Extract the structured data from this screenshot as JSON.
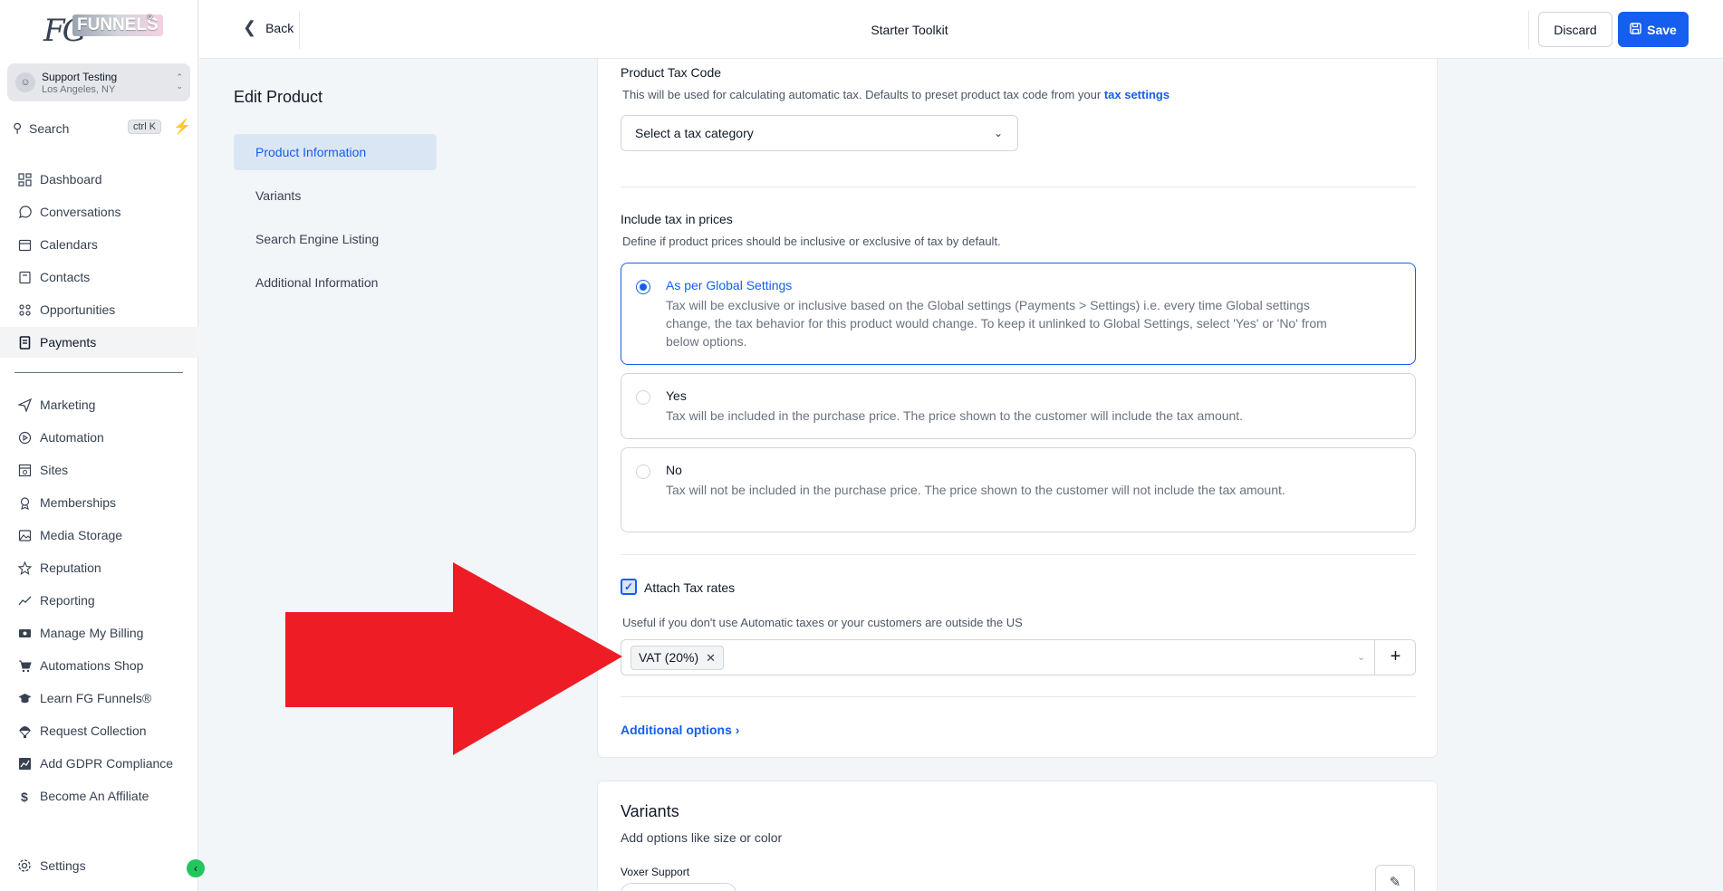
{
  "brand": {
    "logo_fg": "FG",
    "logo_funnels": "FUNNELS",
    "logo_reg": "®"
  },
  "account": {
    "name": "Support Testing",
    "location": "Los Angeles, NY"
  },
  "search": {
    "label": "Search",
    "shortcut": "ctrl K"
  },
  "sidebar": {
    "items": [
      {
        "label": "Dashboard",
        "icon": "dashboard-icon"
      },
      {
        "label": "Conversations",
        "icon": "chat-icon"
      },
      {
        "label": "Calendars",
        "icon": "calendar-icon"
      },
      {
        "label": "Contacts",
        "icon": "contacts-icon"
      },
      {
        "label": "Opportunities",
        "icon": "opportunities-icon"
      },
      {
        "label": "Payments",
        "icon": "payments-icon",
        "active": true
      },
      {
        "label": "Marketing",
        "icon": "send-icon"
      },
      {
        "label": "Automation",
        "icon": "automation-icon"
      },
      {
        "label": "Sites",
        "icon": "sites-icon"
      },
      {
        "label": "Memberships",
        "icon": "memberships-icon"
      },
      {
        "label": "Media Storage",
        "icon": "image-icon"
      },
      {
        "label": "Reputation",
        "icon": "star-icon"
      },
      {
        "label": "Reporting",
        "icon": "chart-icon"
      },
      {
        "label": "Manage My Billing",
        "icon": "billing-icon"
      },
      {
        "label": "Automations Shop",
        "icon": "cart-icon"
      },
      {
        "label": "Learn FG Funnels®",
        "icon": "graduation-icon"
      },
      {
        "label": "Request Collection",
        "icon": "parachute-icon"
      },
      {
        "label": "Add GDPR Compliance",
        "icon": "gdpr-icon"
      },
      {
        "label": "Become An Affiliate",
        "icon": "dollar-icon"
      }
    ],
    "settings": "Settings"
  },
  "topbar": {
    "back": "Back",
    "title": "Starter Toolkit",
    "discard": "Discard",
    "save": "Save"
  },
  "edit": {
    "title": "Edit Product",
    "nav": [
      "Product Information",
      "Variants",
      "Search Engine Listing",
      "Additional Information"
    ]
  },
  "tax": {
    "code_label": "Product Tax Code",
    "code_help": "This will be used for calculating automatic tax. Defaults to preset product tax code from your ",
    "code_link": "tax settings",
    "select_placeholder": "Select a tax category",
    "include_label": "Include tax in prices",
    "include_help": "Define if product prices should be inclusive or exclusive of tax by default.",
    "options": [
      {
        "title": "As per Global Settings",
        "desc": "Tax will be exclusive or inclusive based on the Global settings (Payments > Settings) i.e. every time Global settings change, the tax behavior for this product would change. To keep it unlinked to Global Settings, select 'Yes' or 'No' from below options."
      },
      {
        "title": "Yes",
        "desc": "Tax will be included in the purchase price. The price shown to the customer will include the tax amount."
      },
      {
        "title": "No",
        "desc": "Tax will not be included in the purchase price. The price shown to the customer will not include the tax amount."
      }
    ],
    "attach_label": "Attach Tax rates",
    "attach_help": "Useful if you don't use Automatic taxes or your customers are outside the US",
    "tag": "VAT (20%)",
    "additional": "Additional options"
  },
  "variants": {
    "title": "Variants",
    "subtitle": "Add options like size or color",
    "support": "Voxer Support"
  },
  "colors": {
    "accent": "#155eef",
    "arrow": "#ee1c25"
  }
}
